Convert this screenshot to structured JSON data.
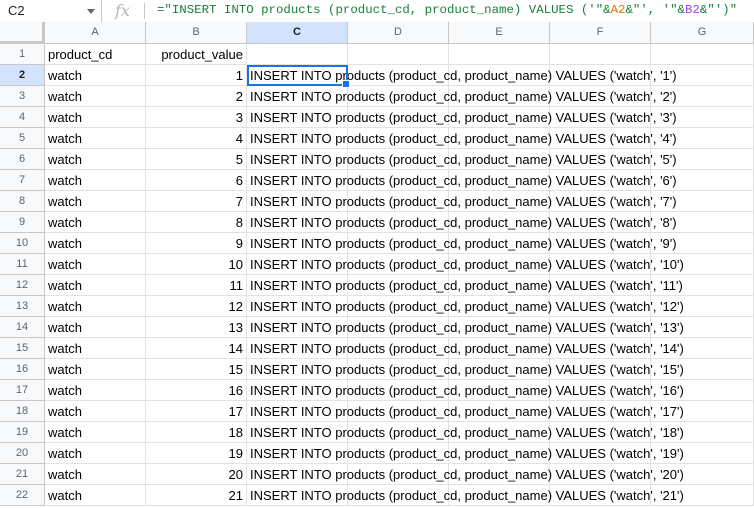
{
  "name_box": "C2",
  "fx_label": "fx",
  "formula": {
    "part1": "=\"INSERT INTO products (product_cd, product_name) VALUES ('\"&",
    "ref1": "A2",
    "part2": "&\"', '\"&",
    "ref2": "B2",
    "part3": "&\"')\""
  },
  "columns": [
    "A",
    "B",
    "C",
    "D",
    "E",
    "F",
    "G"
  ],
  "selected_cell": "C2",
  "header_row": {
    "num": "1",
    "a": "product_cd",
    "b": "product_value",
    "c": ""
  },
  "rows": [
    {
      "num": "2",
      "a": "watch",
      "b": "1",
      "c": "INSERT INTO products (product_cd, product_name) VALUES ('watch', '1')"
    },
    {
      "num": "3",
      "a": "watch",
      "b": "2",
      "c": "INSERT INTO products (product_cd, product_name) VALUES ('watch', '2')"
    },
    {
      "num": "4",
      "a": "watch",
      "b": "3",
      "c": "INSERT INTO products (product_cd, product_name) VALUES ('watch', '3')"
    },
    {
      "num": "5",
      "a": "watch",
      "b": "4",
      "c": "INSERT INTO products (product_cd, product_name) VALUES ('watch', '4')"
    },
    {
      "num": "6",
      "a": "watch",
      "b": "5",
      "c": "INSERT INTO products (product_cd, product_name) VALUES ('watch', '5')"
    },
    {
      "num": "7",
      "a": "watch",
      "b": "6",
      "c": "INSERT INTO products (product_cd, product_name) VALUES ('watch', '6')"
    },
    {
      "num": "8",
      "a": "watch",
      "b": "7",
      "c": "INSERT INTO products (product_cd, product_name) VALUES ('watch', '7')"
    },
    {
      "num": "9",
      "a": "watch",
      "b": "8",
      "c": "INSERT INTO products (product_cd, product_name) VALUES ('watch', '8')"
    },
    {
      "num": "10",
      "a": "watch",
      "b": "9",
      "c": "INSERT INTO products (product_cd, product_name) VALUES ('watch', '9')"
    },
    {
      "num": "11",
      "a": "watch",
      "b": "10",
      "c": "INSERT INTO products (product_cd, product_name) VALUES ('watch', '10')"
    },
    {
      "num": "12",
      "a": "watch",
      "b": "11",
      "c": "INSERT INTO products (product_cd, product_name) VALUES ('watch', '11')"
    },
    {
      "num": "13",
      "a": "watch",
      "b": "12",
      "c": "INSERT INTO products (product_cd, product_name) VALUES ('watch', '12')"
    },
    {
      "num": "14",
      "a": "watch",
      "b": "13",
      "c": "INSERT INTO products (product_cd, product_name) VALUES ('watch', '13')"
    },
    {
      "num": "15",
      "a": "watch",
      "b": "14",
      "c": "INSERT INTO products (product_cd, product_name) VALUES ('watch', '14')"
    },
    {
      "num": "16",
      "a": "watch",
      "b": "15",
      "c": "INSERT INTO products (product_cd, product_name) VALUES ('watch', '15')"
    },
    {
      "num": "17",
      "a": "watch",
      "b": "16",
      "c": "INSERT INTO products (product_cd, product_name) VALUES ('watch', '16')"
    },
    {
      "num": "18",
      "a": "watch",
      "b": "17",
      "c": "INSERT INTO products (product_cd, product_name) VALUES ('watch', '17')"
    },
    {
      "num": "19",
      "a": "watch",
      "b": "18",
      "c": "INSERT INTO products (product_cd, product_name) VALUES ('watch', '18')"
    },
    {
      "num": "20",
      "a": "watch",
      "b": "19",
      "c": "INSERT INTO products (product_cd, product_name) VALUES ('watch', '19')"
    },
    {
      "num": "21",
      "a": "watch",
      "b": "20",
      "c": "INSERT INTO products (product_cd, product_name) VALUES ('watch', '20')"
    },
    {
      "num": "22",
      "a": "watch",
      "b": "21",
      "c": "INSERT INTO products (product_cd, product_name) VALUES ('watch', '21')"
    }
  ],
  "colors": {
    "selection": "#1a73e8",
    "formula_string": "#188038",
    "ref_a2": "#e37400",
    "ref_b2": "#a142f4"
  }
}
